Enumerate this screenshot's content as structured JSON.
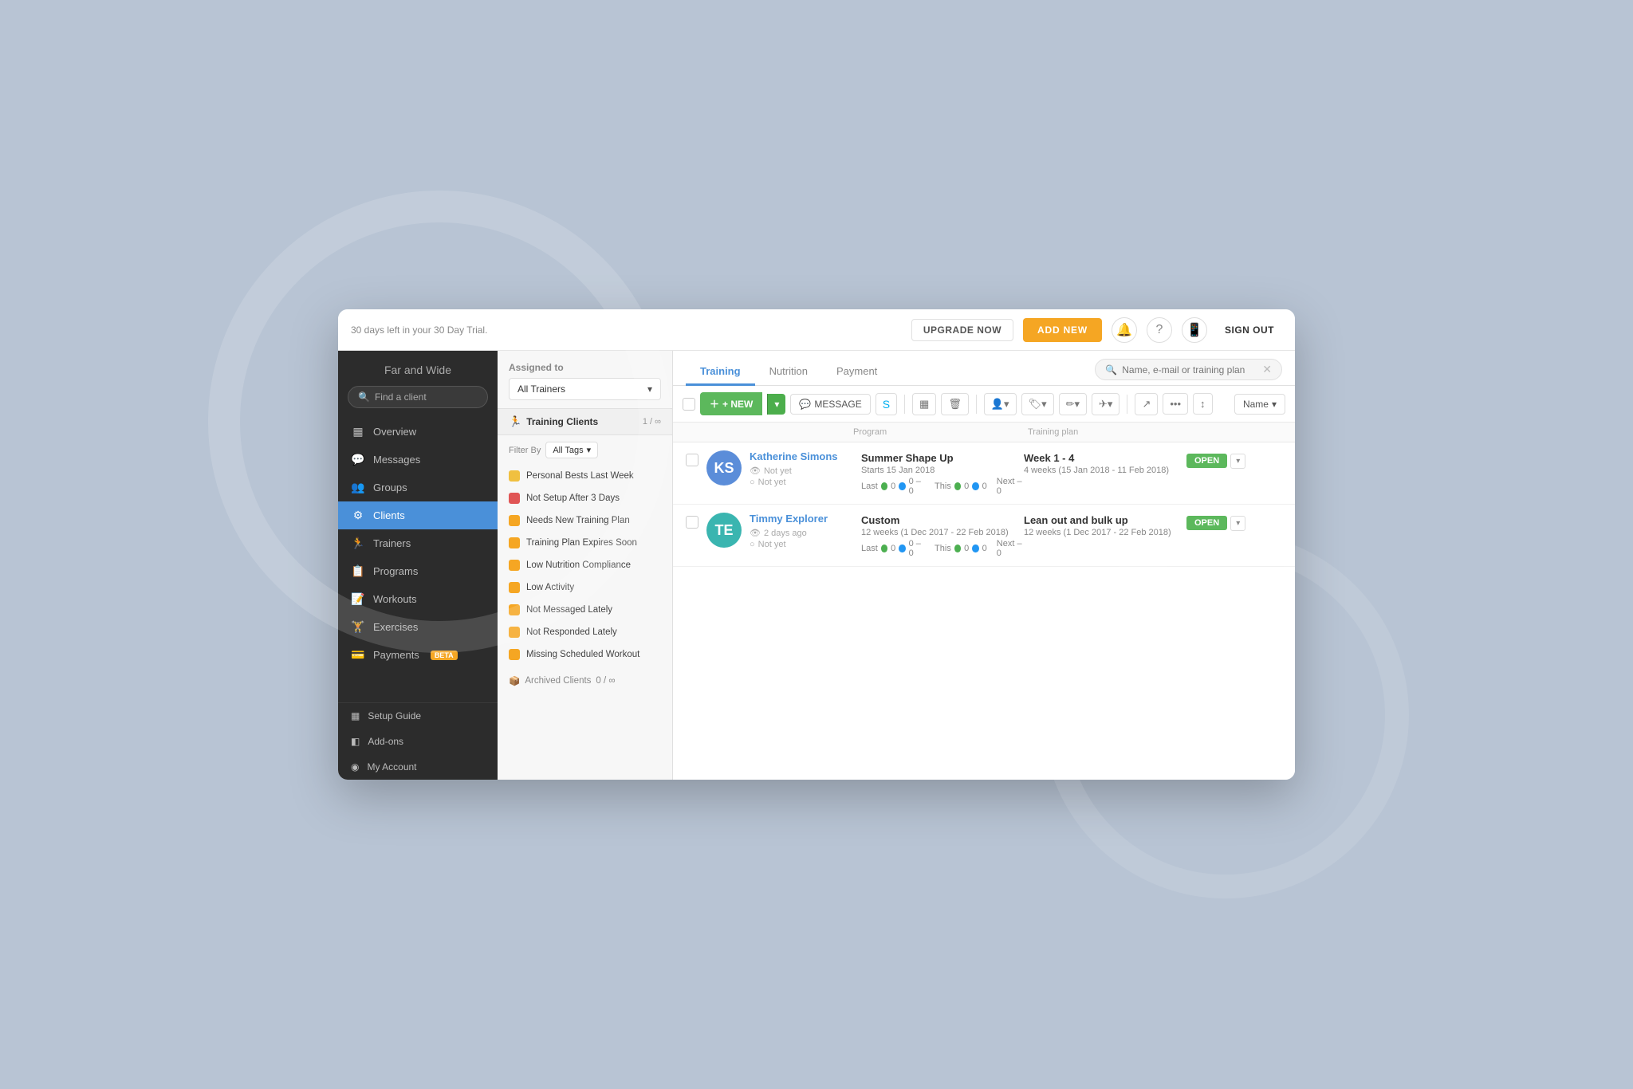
{
  "app": {
    "brand": "Far and Wide",
    "trial_notice": "30 days left in your 30 Day Trial.",
    "upgrade_label": "UPGRADE NOW",
    "add_new_label": "ADD NEW",
    "sign_out_label": "SIGN OUT"
  },
  "sidebar": {
    "search_placeholder": "Find a client",
    "nav_items": [
      {
        "id": "overview",
        "label": "Overview",
        "icon": "▦"
      },
      {
        "id": "messages",
        "label": "Messages",
        "icon": "💬"
      },
      {
        "id": "groups",
        "label": "Groups",
        "icon": "👥"
      },
      {
        "id": "clients",
        "label": "Clients",
        "icon": "⚙",
        "active": true
      },
      {
        "id": "trainers",
        "label": "Trainers",
        "icon": "🏃"
      },
      {
        "id": "programs",
        "label": "Programs",
        "icon": "📋"
      },
      {
        "id": "workouts",
        "label": "Workouts",
        "icon": "📝"
      },
      {
        "id": "exercises",
        "label": "Exercises",
        "icon": "🏋"
      },
      {
        "id": "payments",
        "label": "Payments",
        "icon": "💳",
        "beta": true
      }
    ],
    "bottom_items": [
      {
        "id": "setup-guide",
        "label": "Setup Guide",
        "icon": "▦"
      },
      {
        "id": "add-ons",
        "label": "Add-ons",
        "icon": "◧"
      },
      {
        "id": "my-account",
        "label": "My Account",
        "icon": "◉"
      }
    ]
  },
  "middle_panel": {
    "assigned_to_label": "Assigned to",
    "trainer_dropdown_value": "All Trainers",
    "training_clients_label": "Training Clients",
    "training_clients_count": "1 / ∞",
    "filter_by_label": "Filter By",
    "filter_dropdown_value": "All Tags",
    "filters": [
      {
        "label": "Personal Bests Last Week",
        "color": "gold"
      },
      {
        "label": "Not Setup After 3 Days",
        "color": "red"
      },
      {
        "label": "Needs New Training Plan",
        "color": "orange"
      },
      {
        "label": "Training Plan Expires Soon",
        "color": "orange"
      },
      {
        "label": "Low Nutrition Compliance",
        "color": "orange"
      },
      {
        "label": "Low Activity",
        "color": "orange"
      },
      {
        "label": "Not Messaged Lately",
        "color": "orange"
      },
      {
        "label": "Not Responded Lately",
        "color": "orange"
      },
      {
        "label": "Missing Scheduled Workout",
        "color": "orange"
      }
    ],
    "archived_label": "Archived Clients",
    "archived_count": "0 / ∞"
  },
  "content": {
    "tabs": [
      {
        "id": "training",
        "label": "Training",
        "active": true
      },
      {
        "id": "nutrition",
        "label": "Nutrition",
        "active": false
      },
      {
        "id": "payment",
        "label": "Payment",
        "active": false
      }
    ],
    "search_placeholder": "Name, e-mail or training plan",
    "toolbar": {
      "new_label": "+ NEW",
      "message_label": "MESSAGE"
    },
    "col_headers": {
      "program": "Program",
      "training_plan": "Training plan"
    },
    "sort_label": "Name",
    "clients": [
      {
        "id": "katherine",
        "name": "Katherine Simons",
        "avatar_initials": "KS",
        "avatar_color": "blue",
        "last_seen": "Not yet",
        "last_checkin": "Not yet",
        "program_name": "Summer Shape Up",
        "program_sub": "Starts 15 Jan 2018",
        "program_weeks": "4 weeks (15 Jan 2018 - 11 Feb 2018)",
        "program_stats": "Last ●0 ●0 – 0   This ●0 ●0   Next – 0",
        "plan_name": "Week 1 - 4",
        "plan_sub": "4 weeks (15 Jan 2018 - 11 Feb 2018)",
        "plan_stats": "",
        "status": "OPEN"
      },
      {
        "id": "timmy",
        "name": "Timmy Explorer",
        "avatar_initials": "TE",
        "avatar_color": "teal",
        "last_seen": "2 days ago",
        "last_checkin": "Not yet",
        "program_name": "Custom",
        "program_sub": "",
        "program_weeks": "12 weeks (1 Dec 2017 - 22 Feb 2018)",
        "program_stats": "Last ●0 ●0 – 0   This ●0 ●0   Next – 0",
        "plan_name": "Lean out and bulk up",
        "plan_sub": "12 weeks (1 Dec 2017 - 22 Feb 2018)",
        "plan_stats": "",
        "status": "OPEN"
      }
    ]
  }
}
